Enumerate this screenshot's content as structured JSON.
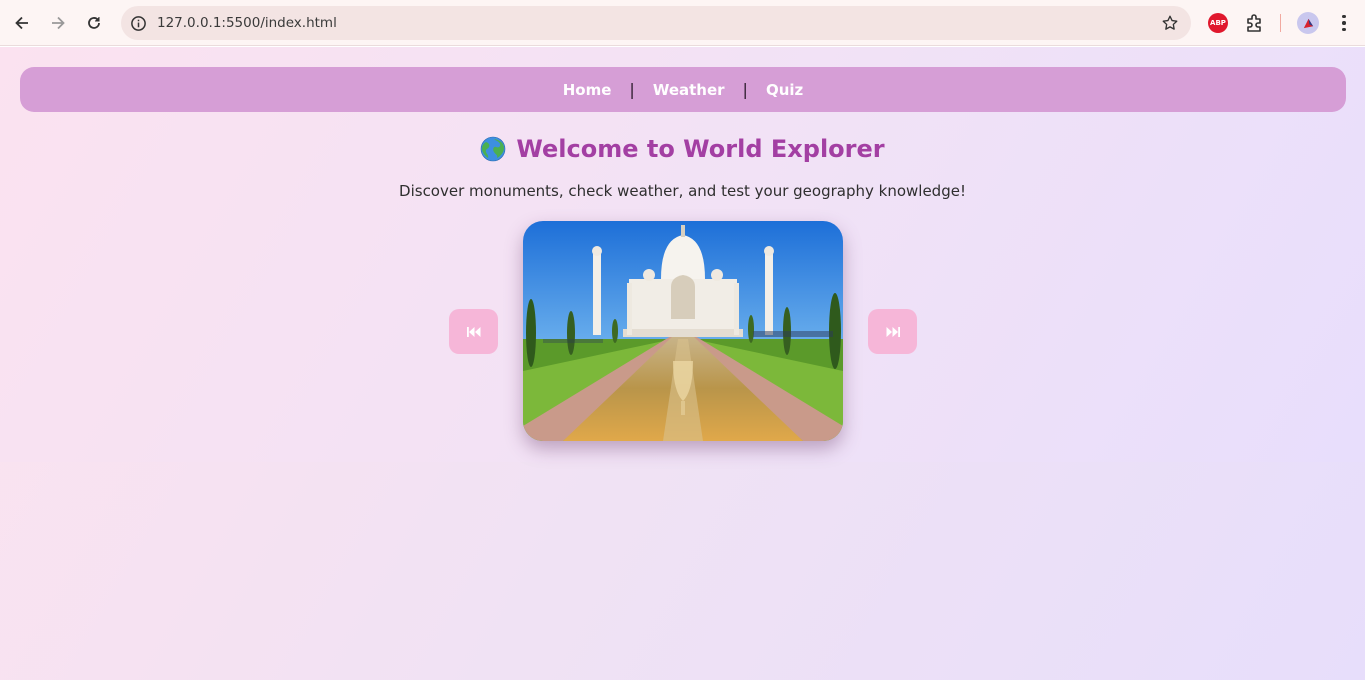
{
  "browser": {
    "url": "127.0.0.1:5500/index.html",
    "icons": {
      "back": "arrow-left-icon",
      "forward": "arrow-right-icon",
      "reload": "reload-icon",
      "site_info": "info-icon",
      "bookmark": "star-icon",
      "adblock": "adblock-icon",
      "extensions": "puzzle-icon",
      "profile": "profile-icon",
      "menu": "kebab-menu-icon"
    },
    "adblock_label": "ABP"
  },
  "nav": {
    "items": [
      {
        "label": "Home"
      },
      {
        "label": "Weather"
      },
      {
        "label": "Quiz"
      }
    ],
    "separator": "|",
    "color": "#d69ed6"
  },
  "hero": {
    "title": "Welcome to World Explorer",
    "title_color": "#a33fa3",
    "subtitle": "Discover monuments, check weather, and test your geography knowledge!"
  },
  "slider": {
    "prev_icon": "previous-track-icon",
    "next_icon": "next-track-icon",
    "image_subject": "taj-mahal-photo",
    "button_color": "#f6b6d8"
  }
}
